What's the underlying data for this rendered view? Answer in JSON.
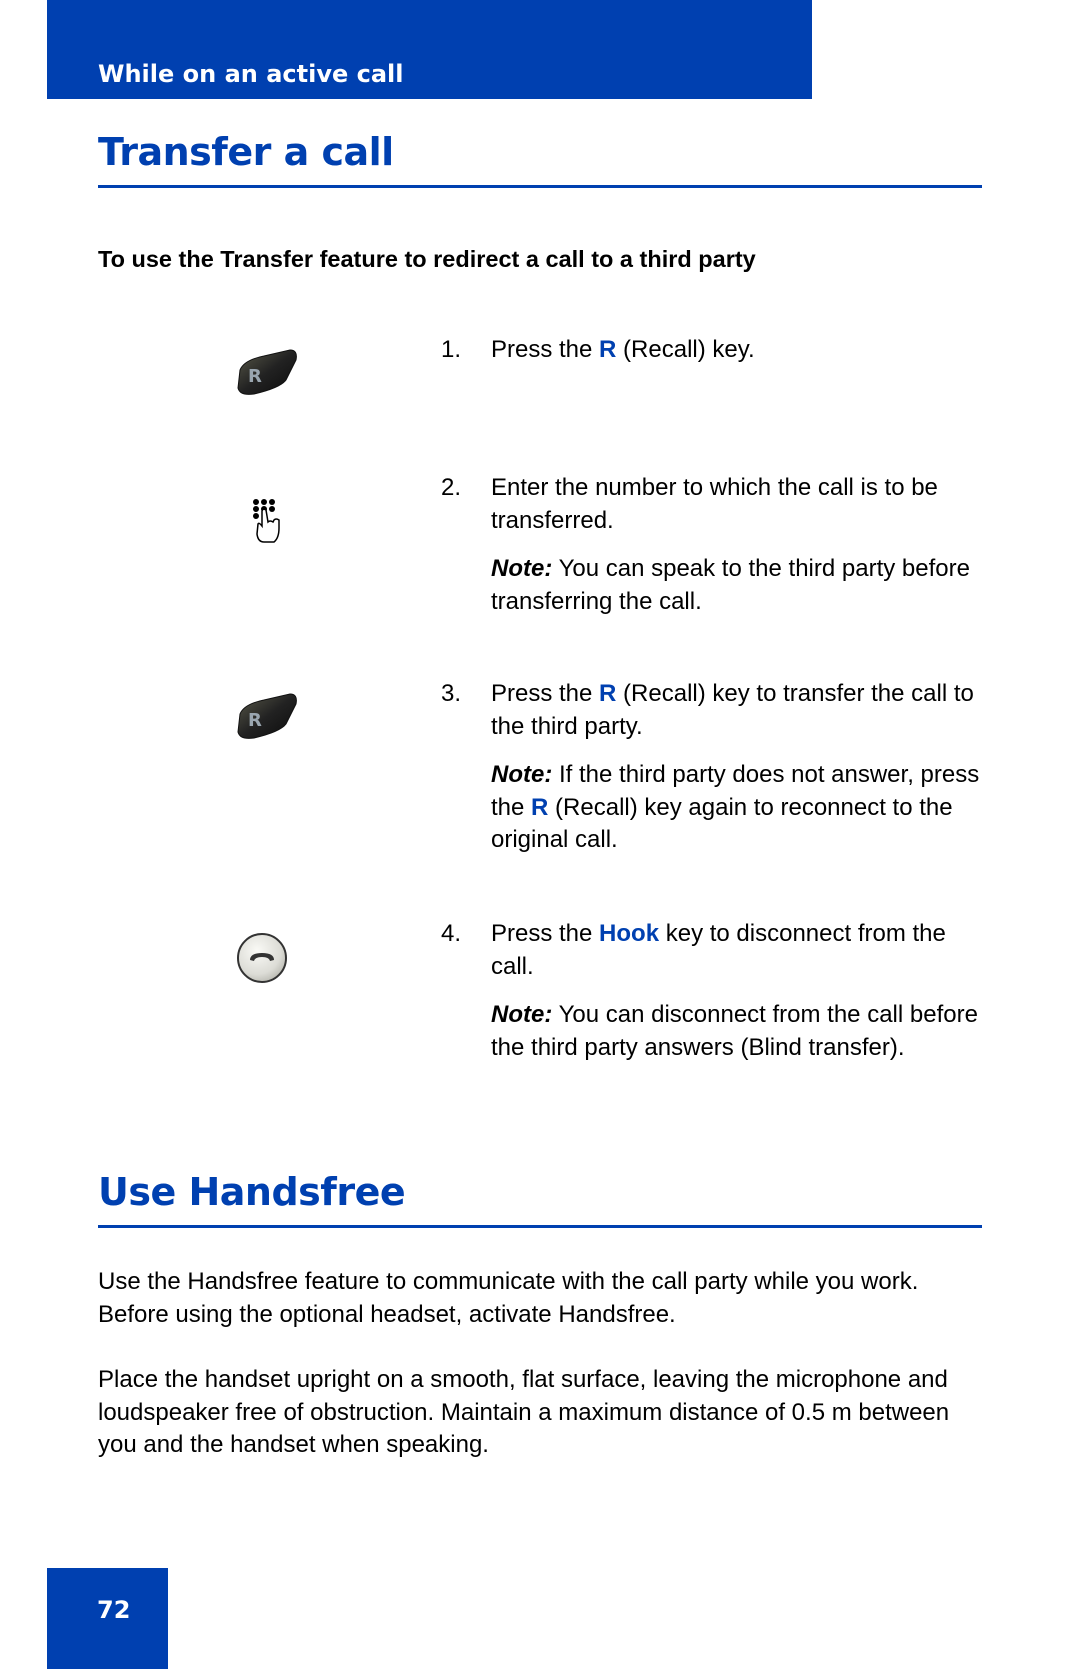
{
  "header": {
    "section": "While on an active call"
  },
  "transfer": {
    "title": "Transfer a call",
    "subheading": "To use the Transfer feature to redirect a call to a third party",
    "steps": [
      {
        "number": "1.",
        "icon": "recall-key-icon",
        "text_before": "Press the ",
        "keyword": "R",
        "text_after": " (Recall) key."
      },
      {
        "number": "2.",
        "icon": "dial-keypad-icon",
        "text": "Enter the number to which the call is to be transferred.",
        "note_label": "Note:",
        "note_text": " You can speak to the third party before transferring the call."
      },
      {
        "number": "3.",
        "icon": "recall-key-icon",
        "text_before": "Press the ",
        "keyword": "R",
        "text_after": " (Recall) key to transfer the call to the third party.",
        "note_label": "Note:",
        "note_before": " If the third party does not answer, press the ",
        "note_keyword": "R",
        "note_after": " (Recall) key again to reconnect to the original call."
      },
      {
        "number": "4.",
        "icon": "hook-key-icon",
        "text_before": "Press the ",
        "keyword": "Hook",
        "text_after": " key to disconnect from the call.",
        "note_label": "Note:",
        "note_text": " You can disconnect from the call before the third party answers (Blind transfer)."
      }
    ]
  },
  "handsfree": {
    "title": "Use Handsfree",
    "paragraphs": [
      "Use the Handsfree feature to communicate with the call party while you work. Before using the optional headset, activate Handsfree.",
      "Place the handset upright on a smooth, flat surface, leaving the microphone and loudspeaker free of obstruction. Maintain a maximum distance of 0.5 m between you and the handset when speaking."
    ]
  },
  "footer": {
    "page_number": "72"
  },
  "colors": {
    "brand_blue": "#0040B0"
  }
}
